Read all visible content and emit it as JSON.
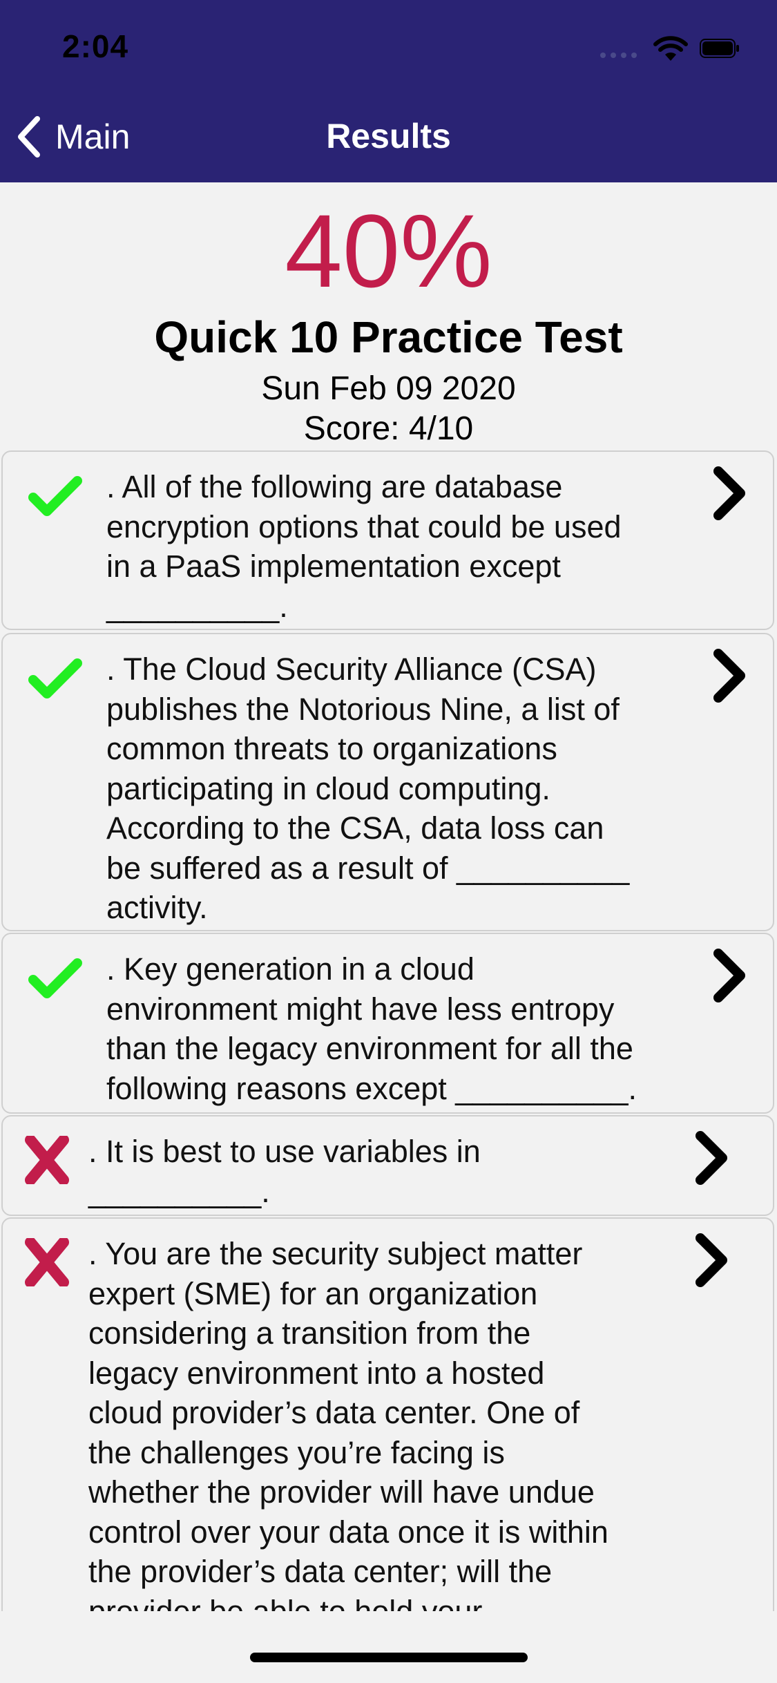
{
  "status_bar": {
    "time": "2:04"
  },
  "nav": {
    "back_label": "Main",
    "title": "Results",
    "bar_color": "#2a2374"
  },
  "summary": {
    "percent": "40%",
    "test_name": "Quick 10 Practice Test",
    "date": "Sun Feb 09 2020",
    "score": "Score: 4/10",
    "percent_color": "#c21d4b"
  },
  "results": [
    {
      "correct": true,
      "icon": "checkmark-icon",
      "text": ". All of the following are database\nencryption options that could be used\nin a PaaS implementation except\n__________."
    },
    {
      "correct": true,
      "icon": "checkmark-icon",
      "text": ". The Cloud Security Alliance (CSA)\npublishes the Notorious Nine, a list of\ncommon threats to organizations\nparticipating in cloud computing.\nAccording to the CSA, data loss can\nbe suffered as a result of __________\nactivity."
    },
    {
      "correct": true,
      "icon": "checkmark-icon",
      "text": ". Key generation in a cloud\nenvironment might have less entropy\nthan the legacy environment for all the\nfollowing reasons except __________."
    },
    {
      "correct": false,
      "icon": "cross-icon",
      "text": ". It is best to use variables in\n__________."
    },
    {
      "correct": false,
      "icon": "cross-icon",
      "text": ". You are the security subject matter\nexpert (SME) for an organization\nconsidering a transition from the\nlegacy environment into a hosted\ncloud provider’s data center. One of\nthe challenges you’re facing is\nwhether the provider will have undue\ncontrol over your data once it is within\nthe provider’s data center; will the\nprovider be able to hold your"
    }
  ],
  "colors": {
    "correct": "#22ee22",
    "incorrect": "#c21d4b"
  }
}
